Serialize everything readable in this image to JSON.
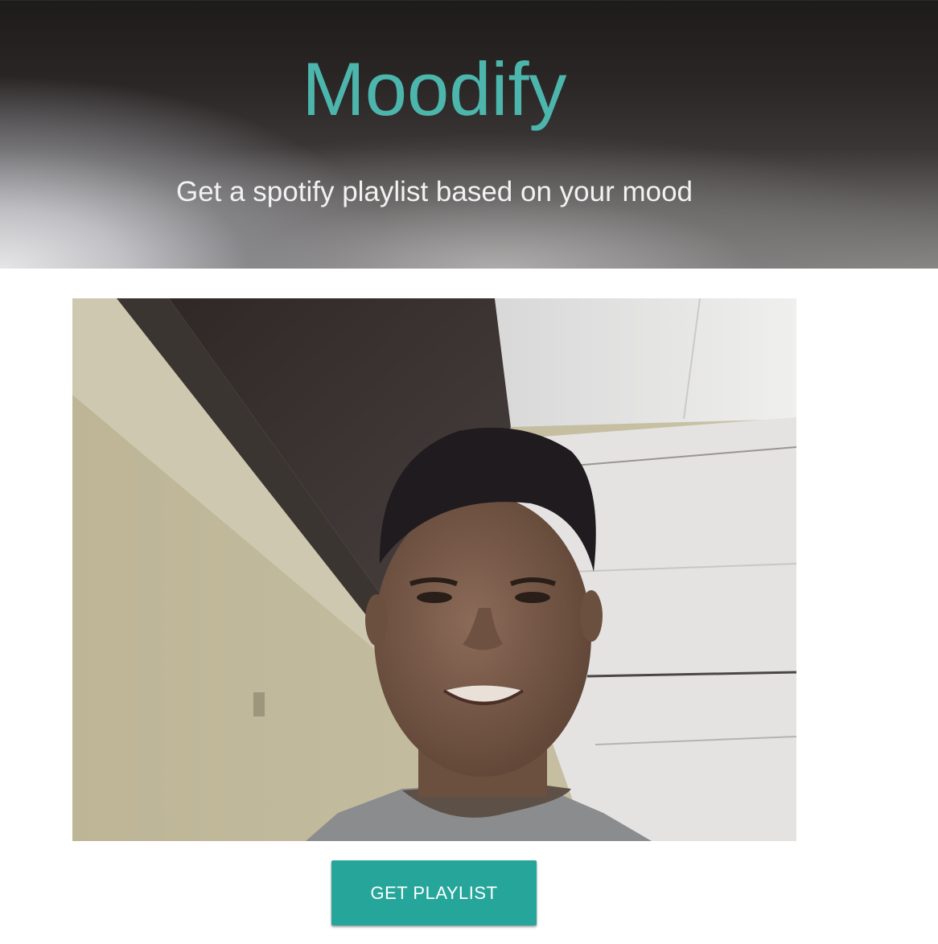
{
  "header": {
    "title": "Moodify",
    "subtitle": "Get a spotify playlist based on your mood"
  },
  "webcam": {
    "content": "webcam-feed"
  },
  "actions": {
    "get_playlist_label": "GET PLAYLIST"
  },
  "colors": {
    "accent": "#4db6ac",
    "button": "#26a69a",
    "header_dark": "#1e1b1b"
  }
}
